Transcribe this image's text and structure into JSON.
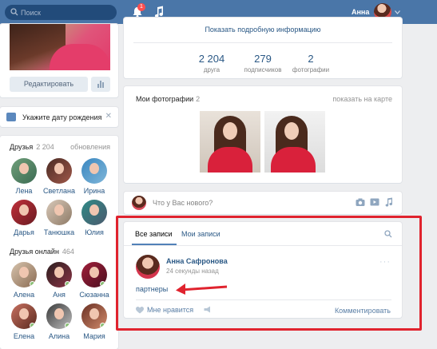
{
  "topbar": {
    "search_placeholder": "Поиск",
    "notifications_count": "1",
    "user_name": "Анна"
  },
  "profile": {
    "edit_button": "Редактировать"
  },
  "birthday": {
    "text": "Укажите дату рождения"
  },
  "friends": {
    "title": "Друзья",
    "count": "2 204",
    "updates": "обновления",
    "items": [
      {
        "name": "Лена"
      },
      {
        "name": "Светлана"
      },
      {
        "name": "Ирина"
      },
      {
        "name": "Дарья"
      },
      {
        "name": "Танюшка"
      },
      {
        "name": "Юлия"
      }
    ]
  },
  "friends_online": {
    "title": "Друзья онлайн",
    "count": "464",
    "items": [
      {
        "name": "Алена"
      },
      {
        "name": "Аня"
      },
      {
        "name": "Сюзанна"
      },
      {
        "name": "Елена"
      },
      {
        "name": "Алина"
      },
      {
        "name": "Мария"
      }
    ]
  },
  "info": {
    "show_more": "Показать подробную информацию",
    "counters": [
      {
        "value": "2 204",
        "label": "друга"
      },
      {
        "value": "279",
        "label": "подписчиков"
      },
      {
        "value": "2",
        "label": "фотографии"
      }
    ]
  },
  "photos": {
    "title": "Мои фотографии",
    "count": "2",
    "map_link": "показать на карте"
  },
  "new_post": {
    "placeholder": "Что у Вас нового?"
  },
  "wall": {
    "tabs": [
      "Все записи",
      "Мои записи"
    ],
    "post": {
      "author": "Анна Сафронова",
      "time": "24 секунды назад",
      "text": "партнеры",
      "like_label": "Мне нравится",
      "comment_label": "Комментировать"
    }
  },
  "colors": {
    "header": "#4a76a8",
    "link": "#2a5885",
    "annotation": "#e0232e"
  }
}
